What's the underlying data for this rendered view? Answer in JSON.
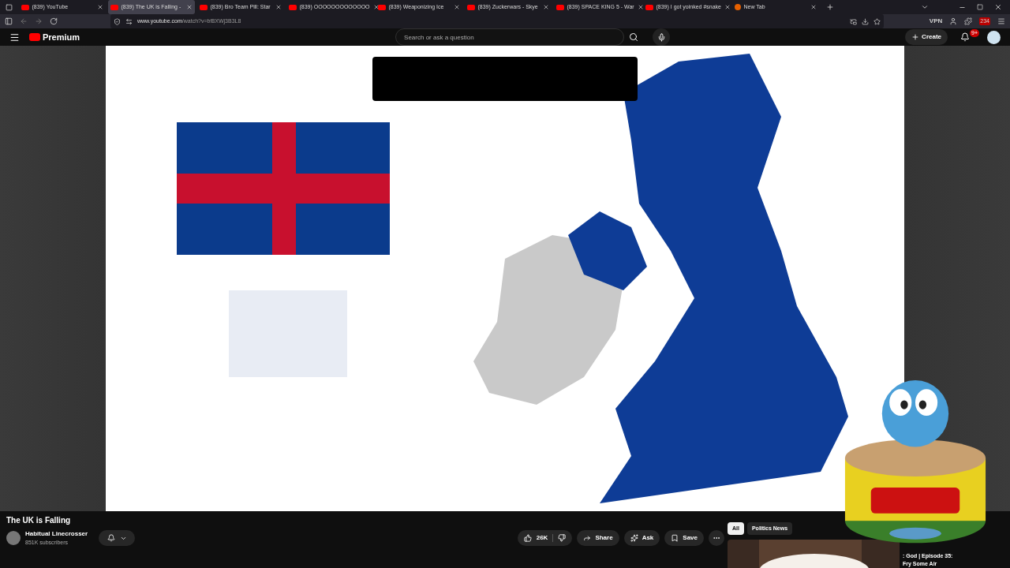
{
  "browser": {
    "tabs": [
      {
        "label": "(839) YouTube",
        "selected": false,
        "kind": "youtube"
      },
      {
        "label": "(839) The UK is Falling -",
        "selected": true,
        "kind": "youtube"
      },
      {
        "label": "(839) Bro Team Pill: Star",
        "selected": false,
        "kind": "youtube"
      },
      {
        "label": "(839) OOOOOOOOOOOOO",
        "selected": false,
        "kind": "youtube"
      },
      {
        "label": "(839) Weaponizing Ice",
        "selected": false,
        "kind": "youtube"
      },
      {
        "label": "(839) Zuckerwars - Skye",
        "selected": false,
        "kind": "youtube"
      },
      {
        "label": "(839) SPACE KING 5 - War",
        "selected": false,
        "kind": "youtube"
      },
      {
        "label": "(839) I got yoinked #snake",
        "selected": false,
        "kind": "youtube"
      },
      {
        "label": "New Tab",
        "selected": false,
        "kind": "newtab"
      }
    ],
    "url_host": "www.youtube.com",
    "url_path": "/watch?v=bf8XWj3B3L8",
    "vpn": "VPN",
    "extension_badge": "234"
  },
  "header": {
    "logo": "Premium",
    "search_placeholder": "Search or ask a question",
    "create": "Create",
    "notifications": "9+"
  },
  "video": {
    "title": "The UK is Falling",
    "channel": "Habitual Linecrosser",
    "subscribers": "851K subscribers",
    "likes": "26K",
    "actions": [
      "Share",
      "Ask",
      "Save"
    ]
  },
  "chips": [
    {
      "label": "All",
      "selected": true
    },
    {
      "label": "Politics News",
      "selected": false
    }
  ],
  "recommended": {
    "title_line_1": ": God | Episode 35:",
    "title_line_2": "Fry Some Air"
  }
}
